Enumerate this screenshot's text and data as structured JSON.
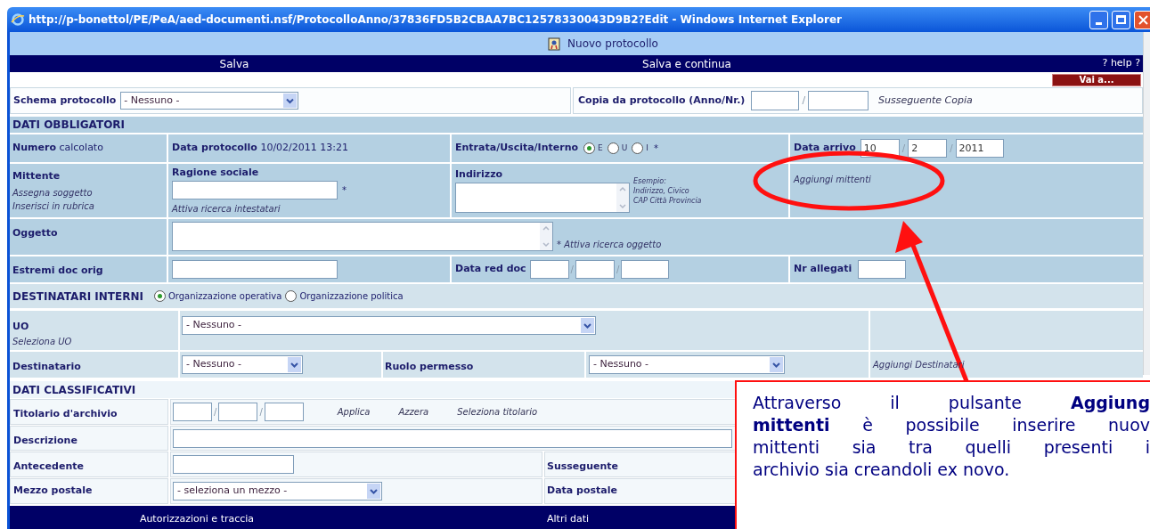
{
  "window": {
    "title": "http://p-bonettol/PE/PeA/aed-documenti.nsf/ProtocolloAnno/37836FD5B2CBAA7BC12578330043D9B2?Edit - Windows Internet Explorer"
  },
  "header": {
    "title": "Nuovo protocollo"
  },
  "toolbar": {
    "actions": [
      "Salva",
      "Salva e continua"
    ],
    "help": "? help ?",
    "goto": "Vai a..."
  },
  "schema": {
    "label": "Schema protocollo",
    "value": "- Nessuno -",
    "copy_label": "Copia da protocollo (Anno/Nr.)",
    "separator": "/",
    "copy_link": "Susseguente Copia"
  },
  "mandatory": {
    "title": "DATI OBBLIGATORI",
    "numero": "**Numero** calcolato",
    "data_protocollo": "**Data protocollo** 10/02/2011 13:21",
    "direction": {
      "label": "Entrata/Uscita/Interno",
      "required": "*",
      "options": [
        {
          "label": "E",
          "selected": true
        },
        {
          "label": "U",
          "selected": false
        },
        {
          "label": "I",
          "selected": false
        }
      ]
    },
    "data_arrivo": {
      "label": "Data arrivo",
      "values": [
        "10",
        "2",
        "2011"
      ],
      "separators": [
        "/",
        "/"
      ]
    },
    "mittente": {
      "label": "Mittente",
      "links": [
        "Assegna soggetto",
        "Inserisci in rubrica"
      ]
    },
    "ragione_sociale": {
      "label": "Ragione sociale",
      "required": "*",
      "link": "Attiva ricerca intestatari"
    },
    "indirizzo": {
      "label": "Indirizzo",
      "hint": [
        "Esempio:",
        "Indirizzo, Civico",
        "CAP Città Provincia"
      ]
    },
    "add_senders": "Aggiungi mittenti",
    "oggetto": {
      "label": "Oggetto",
      "link": "* Attiva ricerca oggetto"
    },
    "estremi": {
      "label": "Estremi doc orig"
    },
    "data_red": {
      "label": "Data red doc",
      "separators": [
        "/",
        "/"
      ]
    },
    "allegati": {
      "label": "Nr allegati"
    }
  },
  "internal": {
    "title": "DESTINATARI INTERNI",
    "options": [
      {
        "label": "Organizzazione operativa",
        "selected": true
      },
      {
        "label": "Organizzazione politica",
        "selected": false
      }
    ],
    "uo": {
      "label": "UO",
      "link": "Seleziona UO",
      "value": "- Nessuno -"
    },
    "destinatario": {
      "label": "Destinatario",
      "value": "- Nessuno -"
    },
    "ruolo": {
      "label": "Ruolo permesso",
      "value": "- Nessuno -"
    },
    "add_recipients": "Aggiungi Destinatari"
  },
  "classification": {
    "title": "DATI CLASSIFICATIVI",
    "titolario": {
      "label": "Titolario d'archivio",
      "separators": [
        "/",
        "/"
      ],
      "actions": [
        "Applica",
        "Azzera",
        "Seleziona titolario"
      ]
    },
    "descrizione": {
      "label": "Descrizione"
    },
    "antecedente": {
      "label": "Antecedente"
    },
    "susseguente": {
      "label": "Susseguente"
    },
    "mezzo": {
      "label": "Mezzo postale",
      "value": "- seleziona un mezzo -"
    },
    "data_postale": {
      "label": "Data postale"
    }
  },
  "bottom_tabs": [
    "Autorizzazioni e traccia",
    "Altri dati"
  ],
  "callout": {
    "lines": [
      "Attraverso il pulsante **Aggiung**",
      "**mittenti** è possibile inserire nuov",
      "mittenti sia tra quelli presenti i",
      "archivio sia creandoli ex novo."
    ]
  }
}
